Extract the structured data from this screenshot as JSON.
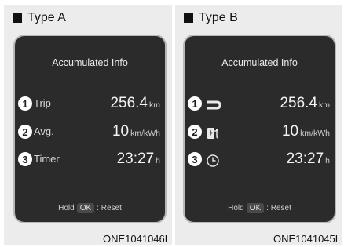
{
  "panels": [
    {
      "title": "Type A",
      "screen_title": "Accumulated Info",
      "rows": [
        {
          "number": "1",
          "label": "Trip",
          "value": "256.4",
          "unit": "km"
        },
        {
          "number": "2",
          "label": "Avg.",
          "value": "10",
          "unit": "km/kWh"
        },
        {
          "number": "3",
          "label": "Timer",
          "value": "23:27",
          "unit": "h"
        }
      ],
      "hold": {
        "prefix": "Hold",
        "button": "OK",
        "suffix": ": Reset"
      },
      "code": "ONE1041046L"
    },
    {
      "title": "Type B",
      "screen_title": "Accumulated Info",
      "rows": [
        {
          "number": "1",
          "icon": "road-icon",
          "value": "256.4",
          "unit": "km"
        },
        {
          "number": "2",
          "icon": "charging-station-icon",
          "value": "10",
          "unit": "km/kWh"
        },
        {
          "number": "3",
          "icon": "clock-icon",
          "value": "23:27",
          "unit": "h"
        }
      ],
      "hold": {
        "prefix": "Hold",
        "button": "OK",
        "suffix": ": Reset"
      },
      "code": "ONE1041045L"
    }
  ]
}
